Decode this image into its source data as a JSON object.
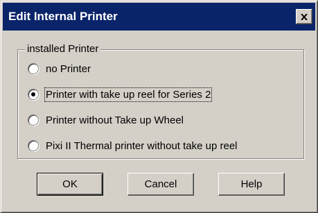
{
  "window": {
    "title": "Edit Internal Printer",
    "close_icon": "close-icon"
  },
  "group": {
    "label": "installed Printer",
    "options": [
      {
        "label": "no Printer",
        "checked": false
      },
      {
        "label": "Printer with take up reel for Series 2",
        "checked": true
      },
      {
        "label": "Printer without Take up Wheel",
        "checked": false
      },
      {
        "label": "Pixi II Thermal printer without take up reel",
        "checked": false
      }
    ]
  },
  "buttons": {
    "ok": "OK",
    "cancel": "Cancel",
    "help": "Help"
  }
}
